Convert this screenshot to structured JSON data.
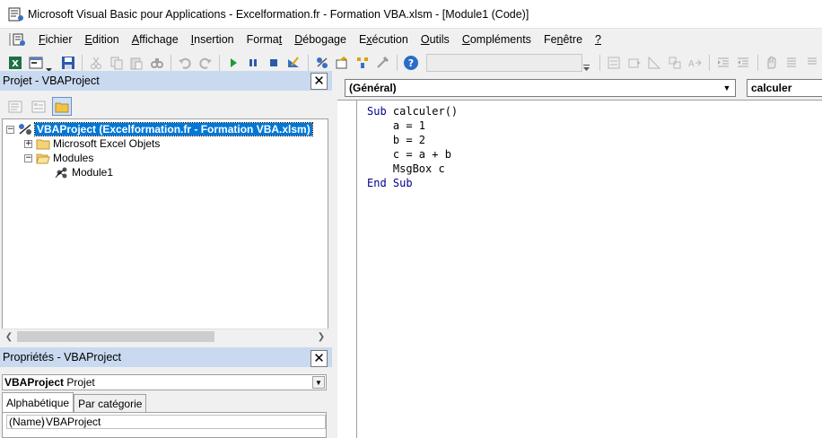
{
  "window": {
    "title": "Microsoft Visual Basic pour Applications - Excelformation.fr - Formation VBA.xlsm - [Module1 (Code)]"
  },
  "menu": [
    {
      "pre": "",
      "ul": "F",
      "post": "ichier",
      "name": "menu-fichier"
    },
    {
      "pre": "",
      "ul": "E",
      "post": "dition",
      "name": "menu-edition"
    },
    {
      "pre": "",
      "ul": "A",
      "post": "ffichage",
      "name": "menu-affichage"
    },
    {
      "pre": "",
      "ul": "I",
      "post": "nsertion",
      "name": "menu-insertion"
    },
    {
      "pre": "Forma",
      "ul": "t",
      "post": "",
      "name": "menu-format"
    },
    {
      "pre": "",
      "ul": "D",
      "post": "ébogage",
      "name": "menu-debogage"
    },
    {
      "pre": "E",
      "ul": "x",
      "post": "écution",
      "name": "menu-execution"
    },
    {
      "pre": "",
      "ul": "O",
      "post": "utils",
      "name": "menu-outils"
    },
    {
      "pre": "",
      "ul": "C",
      "post": "ompléments",
      "name": "menu-complements"
    },
    {
      "pre": "Fe",
      "ul": "n",
      "post": "être",
      "name": "menu-fenetre"
    },
    {
      "pre": "",
      "ul": "?",
      "post": "",
      "name": "menu-aide"
    }
  ],
  "project_pane": {
    "title": "Projet - VBAProject",
    "close": "✕",
    "tree": {
      "root": "VBAProject (Excelformation.fr - Formation VBA.xlsm)",
      "excel_objects": "Microsoft Excel Objets",
      "modules": "Modules",
      "module1": "Module1",
      "expand_symbol": "+",
      "collapse_symbol": "−"
    }
  },
  "properties_pane": {
    "title": "Propriétés - VBAProject",
    "close": "✕",
    "object_name": "VBAProject",
    "object_type": "Projet",
    "tabs": [
      "Alphabétique",
      "Par catégorie"
    ],
    "rows": [
      {
        "key": "(Name)",
        "value": "VBAProject"
      }
    ]
  },
  "code_window": {
    "object_combo": "(Général)",
    "procedure_combo": "calculer",
    "lines": [
      {
        "kw": "Sub",
        "rest": " calculer()"
      },
      {
        "kw": "",
        "rest": "    a = 1"
      },
      {
        "kw": "",
        "rest": "    b = 2"
      },
      {
        "kw": "",
        "rest": "    c = a + b"
      },
      {
        "kw": "",
        "rest": "    MsgBox c"
      },
      {
        "kw": "End Sub",
        "rest": ""
      }
    ]
  },
  "colors": {
    "pane_header": "#c9daf0",
    "selection": "#0078d7",
    "keyword": "#00008b"
  }
}
